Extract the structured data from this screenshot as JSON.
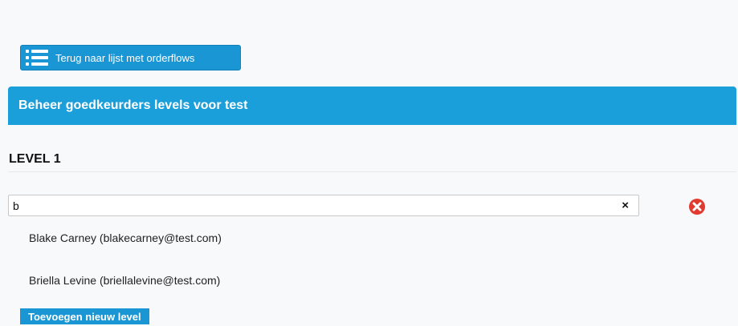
{
  "back_button": {
    "label": "Terug naar lijst met orderflows",
    "icon": "list-icon"
  },
  "header": {
    "title": "Beheer goedkeurders levels voor test"
  },
  "level": {
    "title": "LEVEL 1"
  },
  "search": {
    "value": "b",
    "clear_label": "×"
  },
  "remove_icon": "remove-circle-icon",
  "options": [
    {
      "label": "Blake Carney (blakecarney@test.com)"
    },
    {
      "label": "Briella Levine (briellalevine@test.com)"
    }
  ],
  "add_level_button": {
    "label": "Toevoegen nieuw level"
  },
  "colors": {
    "accent": "#1a9fdb",
    "button": "#1a96d4",
    "danger": "#e03b2e"
  }
}
